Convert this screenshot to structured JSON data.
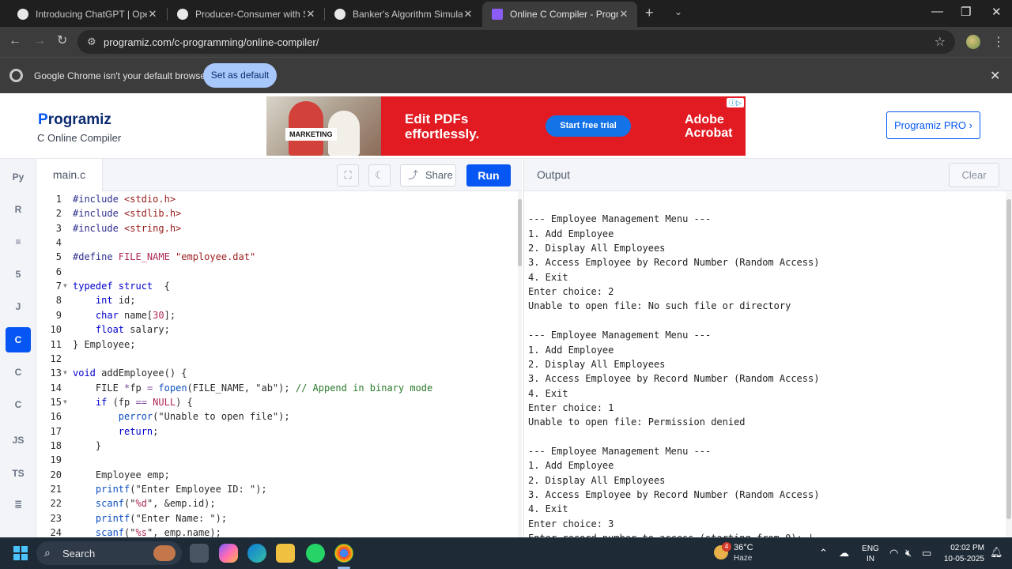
{
  "browser": {
    "tabs": [
      {
        "title": "Introducing ChatGPT | OpenAI",
        "favicon_color": "#e8e8e8",
        "active": false
      },
      {
        "title": "Producer-Consumer with Sema",
        "favicon_color": "#e8e8e8",
        "active": false
      },
      {
        "title": "Banker's Algorithm Simulation",
        "favicon_color": "#e8e8e8",
        "active": false
      },
      {
        "title": "Online C Compiler - Programiz",
        "favicon_color": "#8b5cf6",
        "active": true
      }
    ],
    "url": "programiz.com/c-programming/online-compiler/",
    "infobar": {
      "message": "Google Chrome isn't your default browser",
      "button": "Set as default"
    }
  },
  "site": {
    "logo_prefix": "P",
    "logo_rest": "rogramiz",
    "subtitle": "C Online Compiler",
    "pro_button": "Programiz PRO ›",
    "ad": {
      "tag": "MARKETING",
      "headline": "Edit PDFs effortlessly.",
      "cta": "Start free trial",
      "brand": "Adobe Acrobat"
    }
  },
  "languages": [
    {
      "name": "python-icon",
      "glyph": "Py"
    },
    {
      "name": "r-icon",
      "glyph": "R"
    },
    {
      "name": "sql-icon",
      "glyph": "≡"
    },
    {
      "name": "html-icon",
      "glyph": "5"
    },
    {
      "name": "java-icon",
      "glyph": "J"
    },
    {
      "name": "c-icon",
      "glyph": "C",
      "active": true
    },
    {
      "name": "cpp-icon",
      "glyph": "C"
    },
    {
      "name": "csharp-icon",
      "glyph": "C"
    },
    {
      "name": "javascript-icon",
      "glyph": "JS"
    },
    {
      "name": "typescript-icon",
      "glyph": "TS"
    },
    {
      "name": "go-icon",
      "glyph": "≣"
    }
  ],
  "editor": {
    "filename": "main.c",
    "share_label": "Share",
    "run_label": "Run",
    "lines": [
      {
        "n": "1",
        "fold": false,
        "parts": [
          [
            "inc",
            "#include "
          ],
          [
            "str",
            "<stdio.h>"
          ]
        ]
      },
      {
        "n": "2",
        "fold": false,
        "parts": [
          [
            "inc",
            "#include "
          ],
          [
            "str",
            "<stdlib.h>"
          ]
        ]
      },
      {
        "n": "3",
        "fold": false,
        "parts": [
          [
            "inc",
            "#include "
          ],
          [
            "str",
            "<string.h>"
          ]
        ]
      },
      {
        "n": "4",
        "fold": false,
        "parts": []
      },
      {
        "n": "5",
        "fold": false,
        "parts": [
          [
            "inc",
            "#define "
          ],
          [
            "const",
            "FILE_NAME "
          ],
          [
            "str",
            "\"employee.dat\""
          ]
        ]
      },
      {
        "n": "6",
        "fold": false,
        "parts": []
      },
      {
        "n": "7",
        "fold": true,
        "parts": [
          [
            "kw",
            "typedef struct"
          ],
          [
            "",
            "  {"
          ]
        ]
      },
      {
        "n": "8",
        "fold": false,
        "parts": [
          [
            "",
            "    "
          ],
          [
            "kw",
            "int"
          ],
          [
            "",
            " id;"
          ]
        ]
      },
      {
        "n": "9",
        "fold": false,
        "parts": [
          [
            "",
            "    "
          ],
          [
            "kw",
            "char"
          ],
          [
            "",
            " name["
          ],
          [
            "num",
            "30"
          ],
          [
            "",
            "];"
          ]
        ]
      },
      {
        "n": "10",
        "fold": false,
        "parts": [
          [
            "",
            "    "
          ],
          [
            "kw",
            "float"
          ],
          [
            "",
            " salary;"
          ]
        ]
      },
      {
        "n": "11",
        "fold": false,
        "parts": [
          [
            "",
            "} Employee;"
          ]
        ]
      },
      {
        "n": "12",
        "fold": false,
        "parts": []
      },
      {
        "n": "13",
        "fold": true,
        "parts": [
          [
            "kw",
            "void"
          ],
          [
            "",
            " addEmployee() {"
          ]
        ]
      },
      {
        "n": "14",
        "fold": false,
        "parts": [
          [
            "",
            "    FILE "
          ],
          [
            "op",
            "*"
          ],
          [
            "",
            "fp "
          ],
          [
            "op",
            "="
          ],
          [
            "",
            " "
          ],
          [
            "fn",
            "fopen"
          ],
          [
            "",
            "(FILE_NAME, "
          ],
          [
            "",
            "\"ab\""
          ],
          [
            "",
            "); "
          ],
          [
            "cm",
            "// Append in binary mode"
          ]
        ]
      },
      {
        "n": "15",
        "fold": true,
        "parts": [
          [
            "",
            "    "
          ],
          [
            "kw",
            "if"
          ],
          [
            "",
            " (fp "
          ],
          [
            "op",
            "=="
          ],
          [
            "",
            " "
          ],
          [
            "const",
            "NULL"
          ],
          [
            "",
            ") {"
          ]
        ]
      },
      {
        "n": "16",
        "fold": false,
        "parts": [
          [
            "",
            "        "
          ],
          [
            "fn",
            "perror"
          ],
          [
            "",
            "(\"Unable to open file\");"
          ]
        ]
      },
      {
        "n": "17",
        "fold": false,
        "parts": [
          [
            "",
            "        "
          ],
          [
            "kw",
            "return"
          ],
          [
            "",
            ";"
          ]
        ]
      },
      {
        "n": "18",
        "fold": false,
        "parts": [
          [
            "",
            "    }"
          ]
        ]
      },
      {
        "n": "19",
        "fold": false,
        "parts": []
      },
      {
        "n": "20",
        "fold": false,
        "parts": [
          [
            "",
            "    Employee emp;"
          ]
        ]
      },
      {
        "n": "21",
        "fold": false,
        "parts": [
          [
            "",
            "    "
          ],
          [
            "fn",
            "printf"
          ],
          [
            "",
            "(\"Enter Employee ID: \");"
          ]
        ]
      },
      {
        "n": "22",
        "fold": false,
        "parts": [
          [
            "",
            "    "
          ],
          [
            "fn",
            "scanf"
          ],
          [
            "",
            "(\""
          ],
          [
            "num",
            "%d"
          ],
          [
            "",
            "\", &emp.id);"
          ]
        ]
      },
      {
        "n": "23",
        "fold": false,
        "parts": [
          [
            "",
            "    "
          ],
          [
            "fn",
            "printf"
          ],
          [
            "",
            "(\"Enter Name: \");"
          ]
        ]
      },
      {
        "n": "24",
        "fold": false,
        "parts": [
          [
            "",
            "    "
          ],
          [
            "fn",
            "scanf"
          ],
          [
            "",
            "(\""
          ],
          [
            "num",
            "%s"
          ],
          [
            "",
            "\", emp.name);"
          ]
        ]
      }
    ]
  },
  "output": {
    "title": "Output",
    "clear_label": "Clear",
    "lines": [
      "",
      "--- Employee Management Menu ---",
      "1. Add Employee",
      "2. Display All Employees",
      "3. Access Employee by Record Number (Random Access)",
      "4. Exit",
      "Enter choice: 2",
      "Unable to open file: No such file or directory",
      "",
      "--- Employee Management Menu ---",
      "1. Add Employee",
      "2. Display All Employees",
      "3. Access Employee by Record Number (Random Access)",
      "4. Exit",
      "Enter choice: 1",
      "Unable to open file: Permission denied",
      "",
      "--- Employee Management Menu ---",
      "1. Add Employee",
      "2. Display All Employees",
      "3. Access Employee by Record Number (Random Access)",
      "4. Exit",
      "Enter choice: 3",
      "Enter record number to access (starting from 0): |"
    ]
  },
  "taskbar": {
    "search_label": "Search",
    "weather_badge": "4",
    "temperature": "36°C",
    "condition": "Haze",
    "lang_line1": "ENG",
    "lang_line2": "IN",
    "time": "02:02 PM",
    "date": "10-05-2025"
  }
}
